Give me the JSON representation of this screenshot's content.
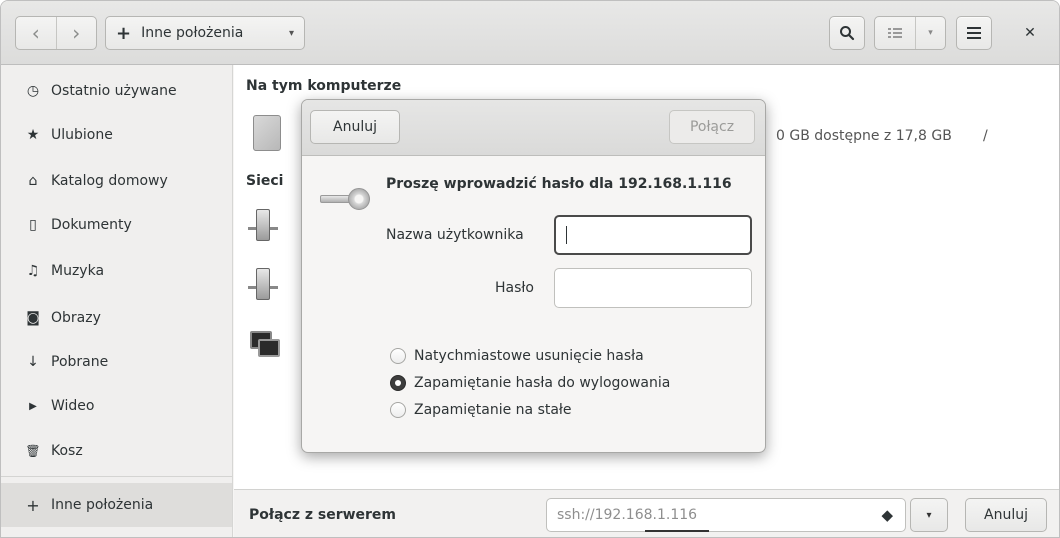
{
  "header": {
    "back_icon": "‹",
    "forward_icon": "›",
    "path_plus": "+",
    "path_label": "Inne położenia",
    "path_caret": "▾",
    "search_icon": "⌕",
    "view_icon": "⁝⁝",
    "view_caret": "▾",
    "menu_icon": "☰",
    "close_icon": "✕"
  },
  "sidebar": {
    "items": [
      {
        "icon": "◷",
        "label": "Ostatnio używane"
      },
      {
        "icon": "★",
        "label": "Ulubione"
      },
      {
        "icon": "⌂",
        "label": "Katalog domowy"
      },
      {
        "icon": "▯",
        "label": "Dokumenty"
      },
      {
        "icon": "♫",
        "label": "Muzyka"
      },
      {
        "icon": "◙",
        "label": "Obrazy"
      },
      {
        "icon": "↓",
        "label": "Pobrane"
      },
      {
        "icon": "▶",
        "label": "Wideo"
      },
      {
        "icon": "🗑",
        "label": "Kosz"
      }
    ],
    "other": {
      "icon": "+",
      "label": "Inne położenia"
    }
  },
  "main": {
    "section_computer": "Na tym komputerze",
    "drive_info": "0 GB dostępne z 17,8 GB",
    "drive_path": "/",
    "section_networks": "Sieci"
  },
  "bottom": {
    "label": "Połącz z serwerem",
    "server_value": "ssh://192.168.1.116",
    "help_icon": "◆",
    "dropdown_caret": "▾",
    "cancel_label": "Anuluj"
  },
  "dialog": {
    "cancel_label": "Anuluj",
    "connect_label": "Połącz",
    "title": "Proszę wprowadzić hasło dla 192.168.1.116",
    "username_label": "Nazwa użytkownika",
    "username_value": "",
    "password_label": "Hasło",
    "password_value": "",
    "options": [
      {
        "label": "Natychmiastowe usunięcie hasła",
        "checked": false
      },
      {
        "label": "Zapamiętanie hasła do wylogowania",
        "checked": true
      },
      {
        "label": "Zapamiętanie na stałe",
        "checked": false
      }
    ]
  }
}
